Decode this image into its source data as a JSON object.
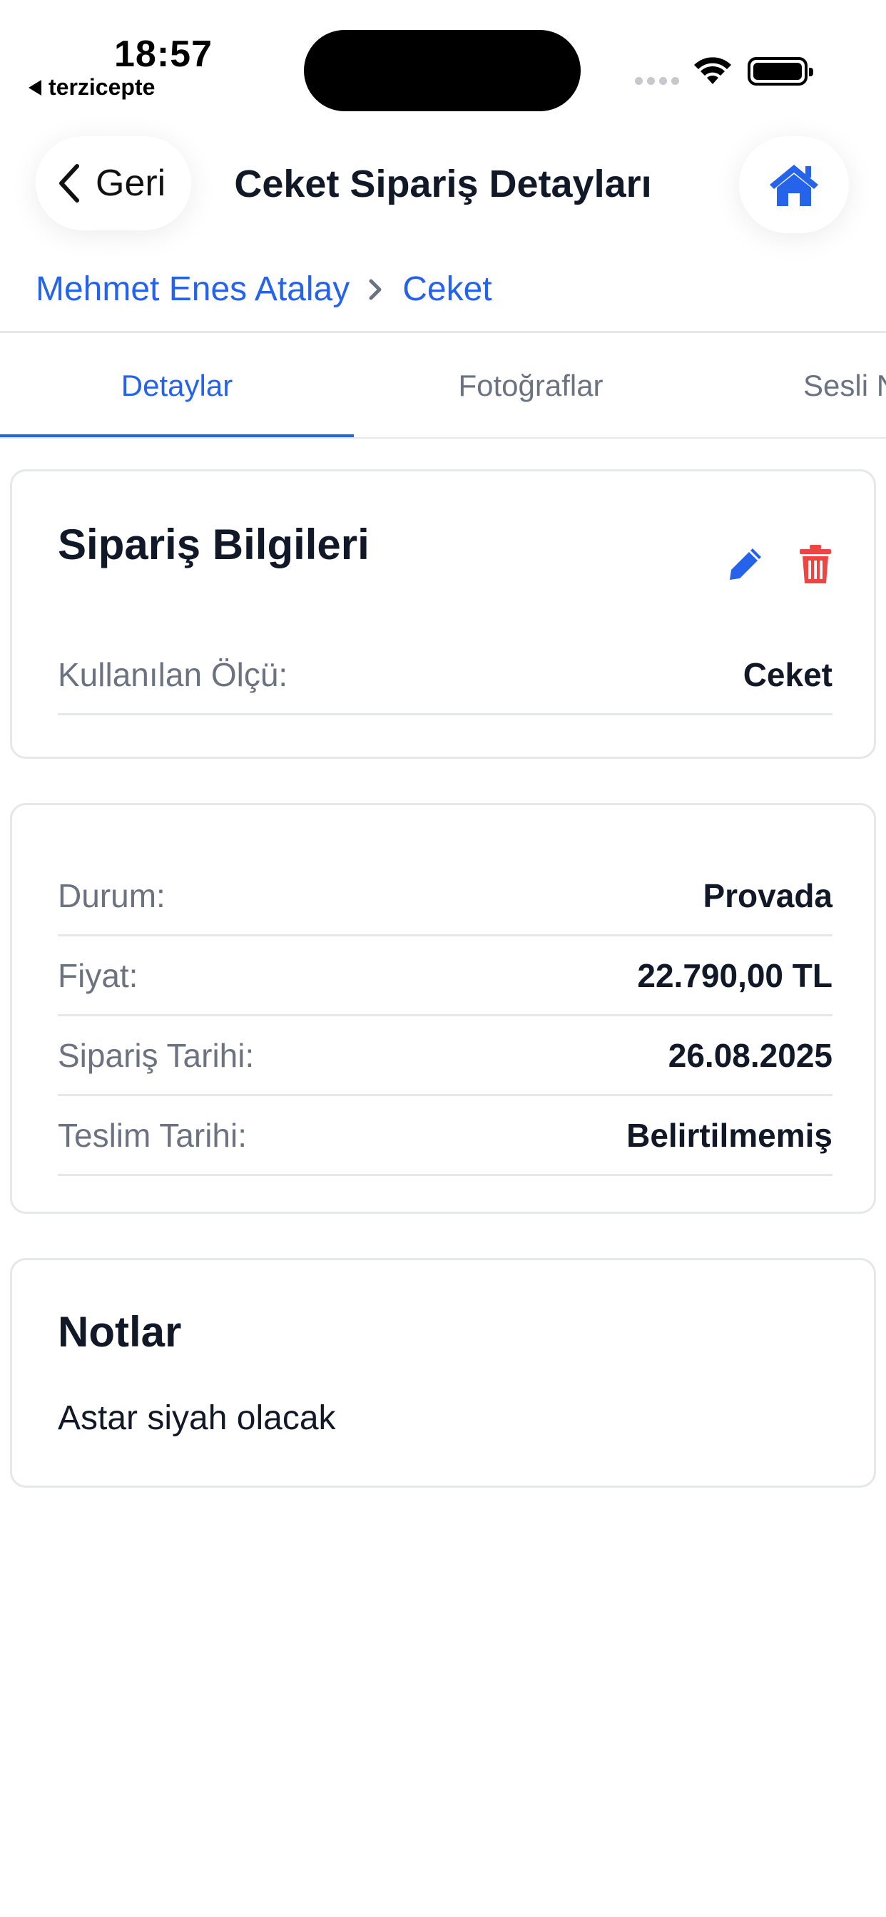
{
  "status_bar": {
    "time": "18:57",
    "back_app": "terzicepte"
  },
  "header": {
    "back_label": "Geri",
    "title": "Ceket Sipariş Detayları"
  },
  "breadcrumb": {
    "customer": "Mehmet Enes Atalay",
    "item": "Ceket"
  },
  "tabs": [
    {
      "label": "Detaylar",
      "active": true
    },
    {
      "label": "Fotoğraflar",
      "active": false
    },
    {
      "label": "Sesli N",
      "active": false
    }
  ],
  "order_info": {
    "title": "Sipariş Bilgileri",
    "rows": [
      {
        "label": "Kullanılan Ölçü:",
        "value": "Ceket"
      }
    ]
  },
  "status_card": {
    "rows": [
      {
        "label": "Durum:",
        "value": "Provada"
      },
      {
        "label": "Fiyat:",
        "value": "22.790,00 TL"
      },
      {
        "label": "Sipariş Tarihi:",
        "value": "26.08.2025"
      },
      {
        "label": "Teslim Tarihi:",
        "value": "Belirtilmemiş"
      }
    ]
  },
  "notes": {
    "title": "Notlar",
    "text": "Astar siyah olacak"
  },
  "colors": {
    "accent": "#2563eb",
    "danger": "#ef4444",
    "muted": "#6b7280",
    "border": "#e5e7eb"
  },
  "icons": [
    "chevron-left-icon",
    "home-icon",
    "chevron-right-icon",
    "pencil-icon",
    "trash-icon",
    "wifi-icon",
    "battery-icon"
  ]
}
